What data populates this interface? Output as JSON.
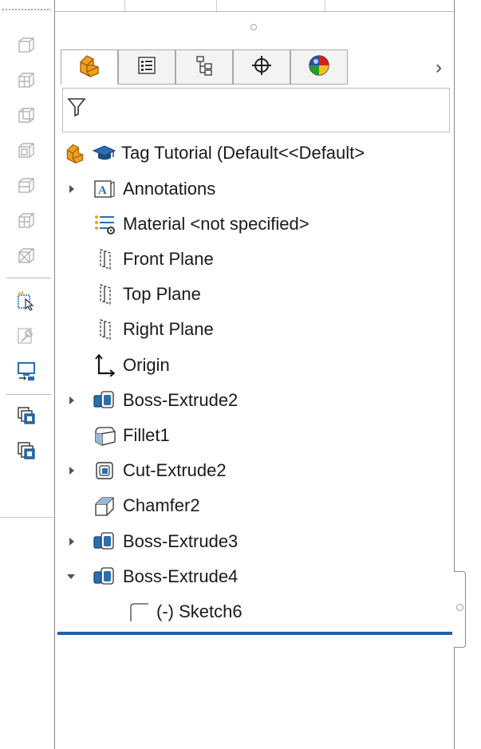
{
  "left_toolbar": {
    "icons": [
      "view-cube-icon",
      "view-front-icon",
      "view-back-icon",
      "view-left-icon",
      "view-right-icon",
      "view-top-icon",
      "view-iso-icon",
      "select-new-icon",
      "wrench-icon",
      "display-pane-icon",
      "copy-icon",
      "paste-icon"
    ]
  },
  "tabs": {
    "items": [
      {
        "name": "featuremanager-tab",
        "icon": "part-icon"
      },
      {
        "name": "propertymanager-tab",
        "icon": "property-list-icon"
      },
      {
        "name": "configurationmanager-tab",
        "icon": "configuration-icon"
      },
      {
        "name": "dimxpert-tab",
        "icon": "crosshair-icon"
      },
      {
        "name": "display-manager-tab",
        "icon": "appearance-ball-icon"
      }
    ],
    "more_arrow": "›"
  },
  "filter": {
    "icon": "filter-funnel-icon"
  },
  "tree": {
    "root": {
      "label": "Tag Tutorial  (Default<<Default>"
    },
    "items": [
      {
        "label": "Annotations",
        "icon": "annotations-icon",
        "expander": "collapsed"
      },
      {
        "label": "Material <not specified>",
        "icon": "material-icon",
        "expander": "none"
      },
      {
        "label": "Front Plane",
        "icon": "plane-icon",
        "expander": "none"
      },
      {
        "label": "Top Plane",
        "icon": "plane-icon",
        "expander": "none"
      },
      {
        "label": "Right Plane",
        "icon": "plane-icon",
        "expander": "none"
      },
      {
        "label": "Origin",
        "icon": "origin-icon",
        "expander": "none"
      },
      {
        "label": "Boss-Extrude2",
        "icon": "boss-extrude-icon",
        "expander": "collapsed"
      },
      {
        "label": "Fillet1",
        "icon": "fillet-icon",
        "expander": "none"
      },
      {
        "label": "Cut-Extrude2",
        "icon": "cut-extrude-icon",
        "expander": "collapsed"
      },
      {
        "label": "Chamfer2",
        "icon": "chamfer-icon",
        "expander": "none"
      },
      {
        "label": "Boss-Extrude3",
        "icon": "boss-extrude-icon",
        "expander": "collapsed"
      },
      {
        "label": "Boss-Extrude4",
        "icon": "boss-extrude-icon",
        "expander": "expanded"
      }
    ],
    "child": {
      "label": "(-) Sketch6",
      "icon": "sketch-icon"
    }
  },
  "colors": {
    "rollback_bar": "#1e5fa8",
    "part_icon": "#f0a020",
    "feature_icon": "#2a6fb0"
  }
}
